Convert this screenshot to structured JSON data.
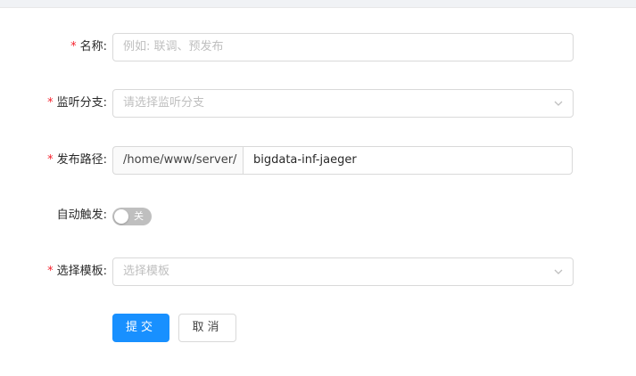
{
  "form": {
    "name": {
      "required": "*",
      "label": "名称:",
      "placeholder": "例如: 联调、预发布"
    },
    "branch": {
      "required": "*",
      "label": "监听分支:",
      "placeholder": "请选择监听分支",
      "icon": "chevron-down-icon"
    },
    "deploy_path": {
      "required": "*",
      "label": "发布路径:",
      "prefix": "/home/www/server/",
      "value": "bigdata-inf-jaeger"
    },
    "auto_trigger": {
      "label": "自动触发:",
      "state_text": "关",
      "enabled": false
    },
    "template": {
      "required": "*",
      "label": "选择模板:",
      "placeholder": "选择模板",
      "icon": "chevron-down-icon"
    }
  },
  "actions": {
    "submit_label": "提交",
    "cancel_label": "取消"
  },
  "colors": {
    "primary": "#1890ff",
    "required": "#f5222d",
    "switch_off": "#bfbfbf"
  }
}
